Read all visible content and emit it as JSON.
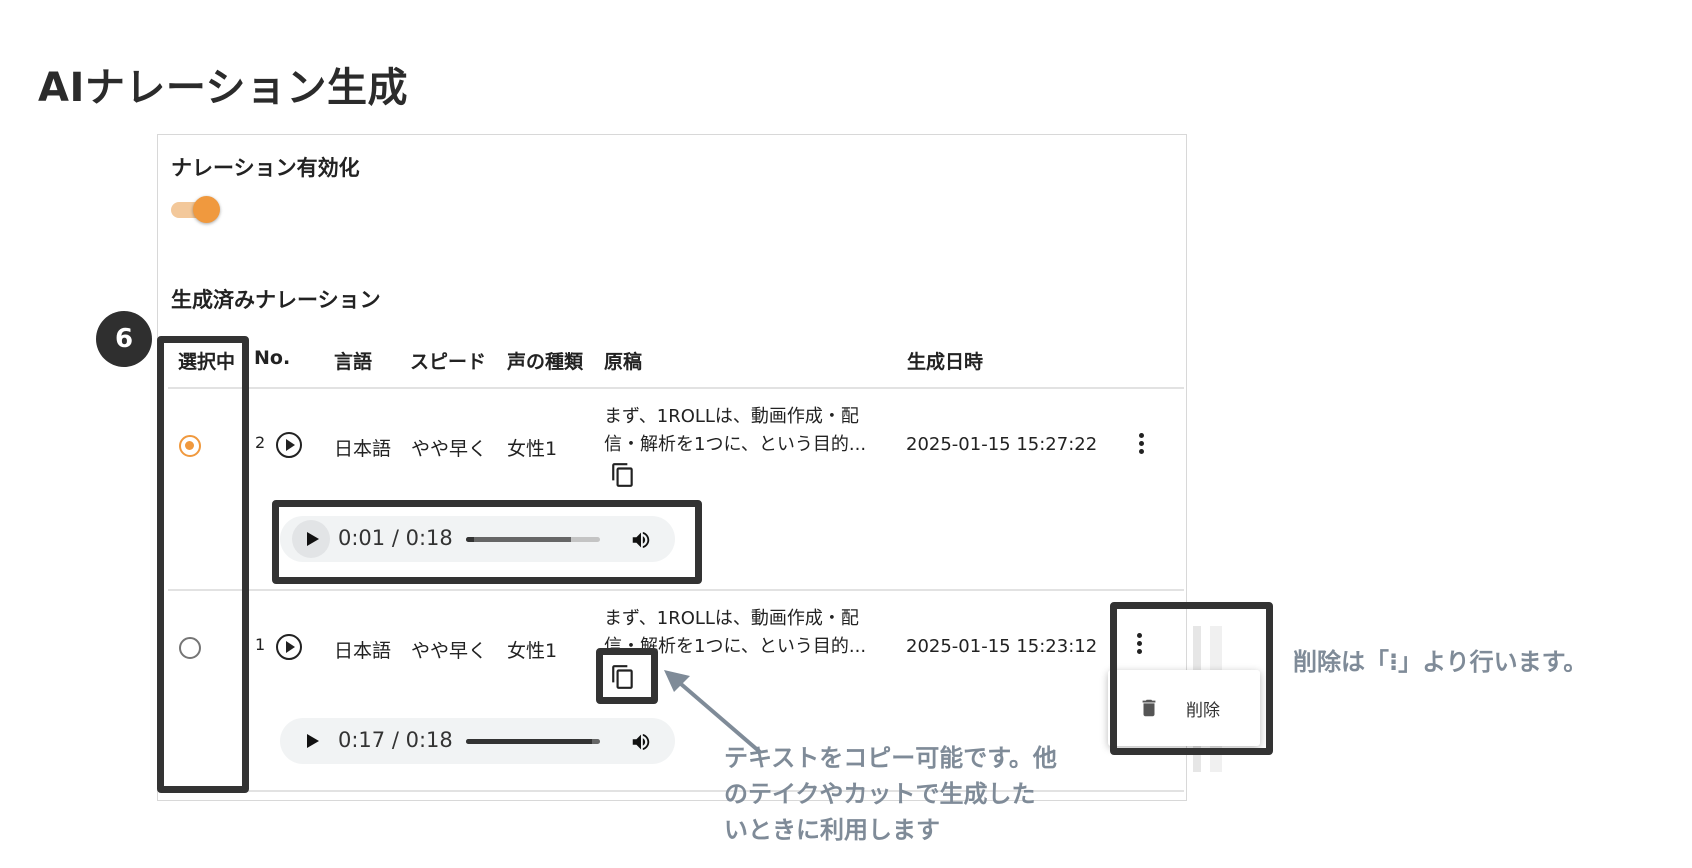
{
  "page": {
    "title": "AIナレーション生成"
  },
  "narration_toggle": {
    "label": "ナレーション有効化",
    "enabled": true
  },
  "generated": {
    "label": "生成済みナレーション",
    "columns": [
      "選択中",
      "No.",
      "言語",
      "スピード",
      "声の種類",
      "原稿",
      "生成日時"
    ],
    "rows": [
      {
        "selected": true,
        "no": "2",
        "language": "日本語",
        "speed": "やや早く",
        "voice": "女性1",
        "manuscript": "まず、1ROLLは、動画作成・配信・解析を1つに、という目的...",
        "created_at": "2025-01-15 15:27:22",
        "player": {
          "time": "0:01 / 0:18",
          "progress": 0.06,
          "buffered": 0.78
        }
      },
      {
        "selected": false,
        "no": "1",
        "language": "日本語",
        "speed": "やや早く",
        "voice": "女性1",
        "manuscript": "まず、1ROLLは、動画作成・配信・解析を1つに、という目的...",
        "created_at": "2025-01-15 15:23:12",
        "player": {
          "time": "0:17 / 0:18",
          "progress": 0.94,
          "buffered": 1.0
        }
      }
    ]
  },
  "context_menu": {
    "delete_label": "削除"
  },
  "annotations": {
    "badge": "6",
    "delete_note": "削除は「⁝」より行います。",
    "copy_note": [
      "テキストをコピー可能です。他",
      "のテイクやカットで生成した",
      "いときに利用します"
    ]
  },
  "colors": {
    "accent": "#f0993e",
    "annotation": "#7f8b98",
    "frame": "#333333"
  },
  "icons": [
    "play-circle-icon",
    "copy-icon",
    "more-vert-icon",
    "volume-icon",
    "trash-icon"
  ]
}
